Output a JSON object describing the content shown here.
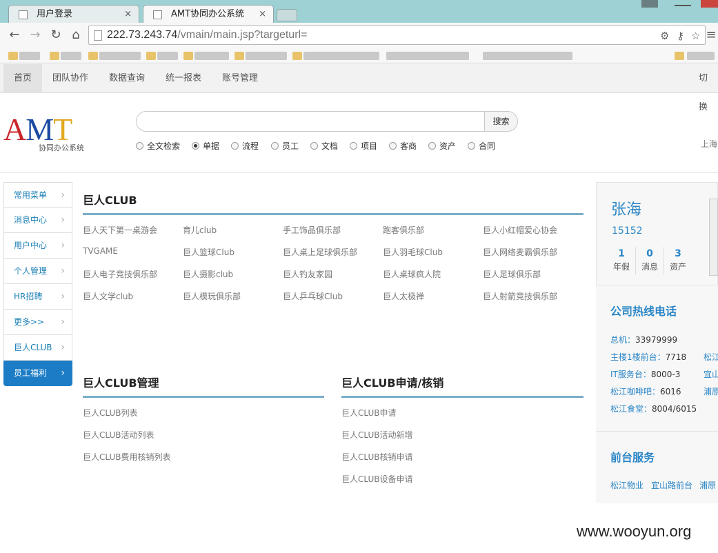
{
  "browser": {
    "tabs": [
      {
        "label": "用户登录",
        "close": "×"
      },
      {
        "label": "AMT协同办公系统",
        "close": "×"
      }
    ],
    "url_host": "222.73.243.74",
    "url_path": "/vmain/main.jsp?targeturl="
  },
  "topnav": {
    "items": [
      "首页",
      "团队协作",
      "数据查询",
      "统一报表",
      "账号管理"
    ],
    "right": "切换"
  },
  "logo": {
    "a": "A",
    "m": "M",
    "t": "T",
    "sub": "协同办公系统"
  },
  "search": {
    "button": "搜索",
    "placeholder": "",
    "options": [
      "全文检索",
      "单据",
      "流程",
      "员工",
      "文档",
      "项目",
      "客商",
      "资产",
      "合同"
    ],
    "selected": "单据",
    "location": "上海"
  },
  "leftmenu": {
    "items": [
      "常用菜单",
      "消息中心",
      "用户中心",
      "个人管理",
      "HR招聘",
      "更多>>",
      "巨人CLUB",
      "员工福利"
    ],
    "active": "员工福利"
  },
  "clubs": {
    "title": "巨人CLUB",
    "rows": [
      [
        "巨人天下第一桌游会",
        "育儿club",
        "手工饰品俱乐部",
        "跑客俱乐部",
        "巨人小红帽爱心协会"
      ],
      [
        "TVGAME",
        "巨人篮球Club",
        "巨人桌上足球俱乐部",
        "巨人羽毛球Club",
        "巨人网络麦霸俱乐部"
      ],
      [
        "巨人电子竞技俱乐部",
        "巨人摄影club",
        "巨人钓友家园",
        "巨人桌球疯人院",
        "巨人足球俱乐部"
      ],
      [
        "巨人文学club",
        "巨人模玩俱乐部",
        "巨人乒乓球Club",
        "巨人太极禅",
        "巨人射箭竞技俱乐部"
      ]
    ]
  },
  "club_manage": {
    "title": "巨人CLUB管理",
    "links": [
      "巨人CLUB列表",
      "巨人CLUB活动列表",
      "巨人CLUB费用核销列表"
    ]
  },
  "club_apply": {
    "title": "巨人CLUB申请/核销",
    "links": [
      "巨人CLUB申请",
      "巨人CLUB活动新增",
      "巨人CLUB核销申请",
      "巨人CLUB设备申请"
    ]
  },
  "user": {
    "name": "张海",
    "id": "15152",
    "stats": [
      {
        "num": "1",
        "label": "年假"
      },
      {
        "num": "0",
        "label": "消息"
      },
      {
        "num": "3",
        "label": "资产"
      }
    ]
  },
  "hotline": {
    "title": "公司热线电话",
    "lines": [
      {
        "label": "总机：",
        "value": "33979999"
      },
      {
        "label": "主楼1楼前台：",
        "value": "7718"
      },
      {
        "label": "IT服务台：",
        "value": "8000-3"
      },
      {
        "label": "松江咖啡吧：",
        "value": "6016"
      },
      {
        "label": "松江食堂：",
        "value": "8004/6015"
      }
    ],
    "cut": [
      "松江",
      "宜山",
      "浦原"
    ]
  },
  "front_service": {
    "title": "前台服务",
    "links": [
      "松江物业",
      "宜山路前台",
      "浦原"
    ]
  },
  "watermark": "www.wooyun.org"
}
